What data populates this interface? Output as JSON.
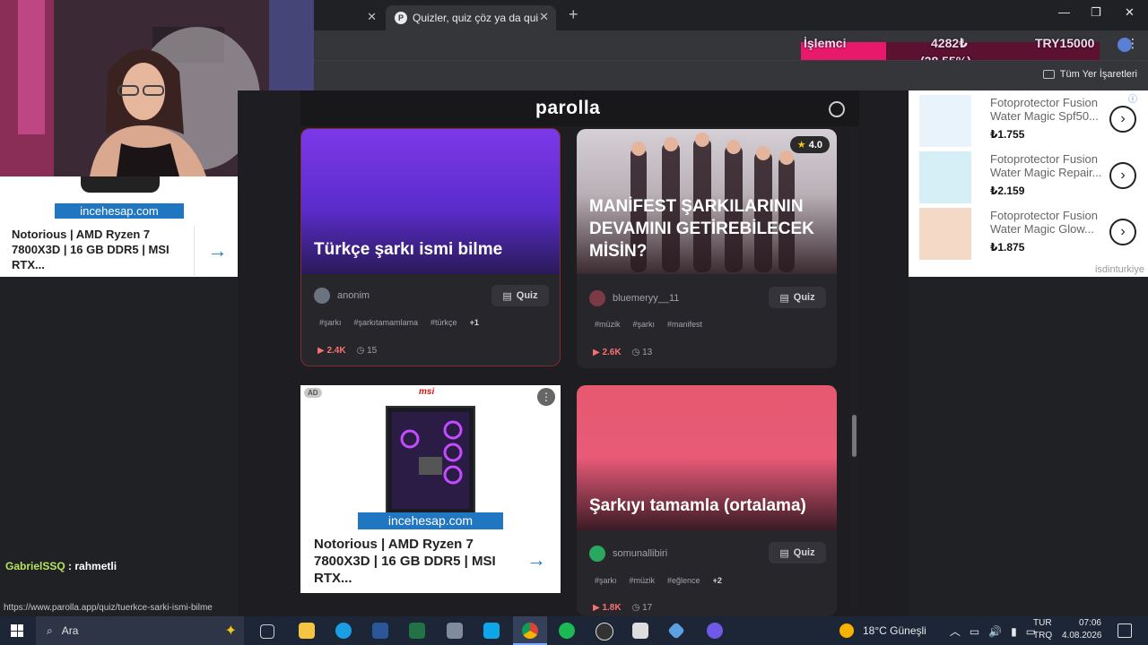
{
  "browser": {
    "tabs": [
      {
        "label": ""
      },
      {
        "label": "Quizler, quiz çöz ya da quiz olu..."
      }
    ],
    "bookmarks_all": "Tüm Yer İşaretleri"
  },
  "overlay": {
    "cpu_label": "İşlemci",
    "amount": "4282₺",
    "percent": "(28.55%)",
    "goal": "TRY15000"
  },
  "site": {
    "logo": "parolla",
    "cards": [
      {
        "title": "Türkçe şarkı ismi bilme",
        "user": "anonim",
        "quiz_label": "Quiz",
        "tags": [
          "#şarkı",
          "#şarkıtamamlama",
          "#türkçe"
        ],
        "more": "+1",
        "plays": "2.4K",
        "questions": "15"
      },
      {
        "title": "MANİFEST ŞARKILARININ DEVAMINI GETİREBİLECEK MİSİN?",
        "rating": "4.0",
        "user": "bluemeryy__11",
        "quiz_label": "Quiz",
        "tags": [
          "#müzik",
          "#şarkı",
          "#manifest"
        ],
        "plays": "2.6K",
        "questions": "13"
      },
      {
        "title": "Şarkıyı tamamla (ortalama)",
        "user": "somunallibiri",
        "quiz_label": "Quiz",
        "tags": [
          "#şarkı",
          "#müzik",
          "#eğlence"
        ],
        "more": "+2",
        "plays": "1.8K",
        "questions": "17"
      }
    ],
    "ad": {
      "badge": "AD",
      "brand_top": "msi",
      "banner": "incehesap.com",
      "title": "Notorious | AMD Ryzen 7 7800X3D | 16 GB DDR5 | MSI RTX..."
    }
  },
  "right_ad": {
    "products": [
      {
        "name": "Fotoprotector Fusion Water Magic Spf50...",
        "price": "₺1.755"
      },
      {
        "name": "Fotoprotector Fusion Water Magic Repair...",
        "price": "₺2.159"
      },
      {
        "name": "Fotoprotector Fusion Water Magic Glow...",
        "price": "₺1.875"
      }
    ],
    "brand": "isdinturkiye"
  },
  "left_ad": {
    "banner": "incehesap.com",
    "title": "Notorious | AMD Ryzen 7 7800X3D | 16 GB DDR5 | MSI RTX..."
  },
  "chat": {
    "user": "GabrielSSQ",
    "message": " : rahmetli"
  },
  "status_url": "https://www.parolla.app/quiz/tuerkce-sarki-ismi-bilme",
  "taskbar": {
    "search": "Ara",
    "weather": "18°C Güneşli",
    "lang1": "TUR",
    "lang2": "TRQ",
    "time": "07:06",
    "date": "4.08.2026"
  },
  "colors": {
    "accent_pink": "#e8186b",
    "plays_red": "#f87171"
  }
}
